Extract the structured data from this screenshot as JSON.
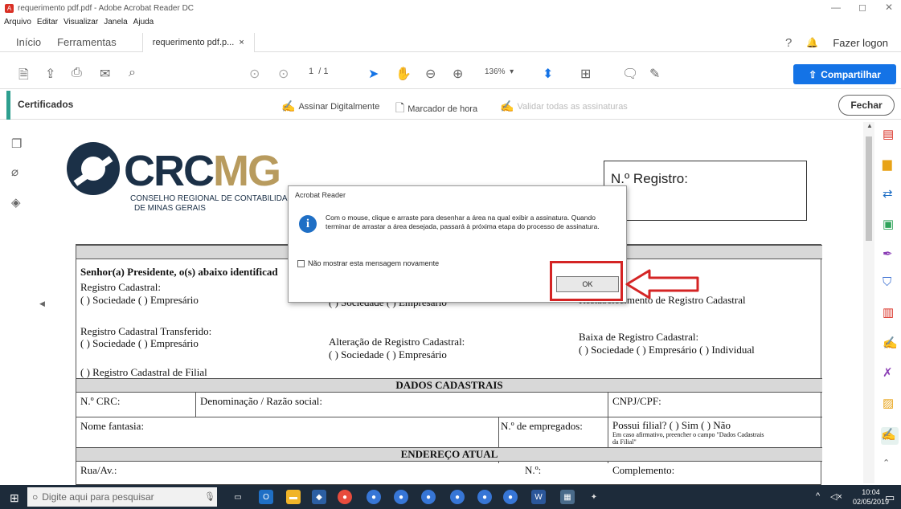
{
  "window": {
    "title": "requerimento pdf.pdf - Adobe Acrobat Reader DC",
    "minimize_icon": "minimize-icon",
    "maximize_icon": "maximize-icon",
    "close_icon": "close-icon"
  },
  "menubar": {
    "items": [
      "Arquivo",
      "Editar",
      "Visualizar",
      "Janela",
      "Ajuda"
    ]
  },
  "tabs": {
    "home": "Início",
    "tools": "Ferramentas",
    "document": "requerimento pdf.p...",
    "close_glyph": "×",
    "login": "Fazer logon"
  },
  "toolbar": {
    "page_current": "1",
    "page_total": "/ 1",
    "zoom": "136%",
    "share_label": "Compartilhar"
  },
  "certificates": {
    "label": "Certificados",
    "sign": "Assinar Digitalmente",
    "timestamp": "Marcador de hora",
    "validate": "Validar todas as assinaturas",
    "close": "Fechar"
  },
  "document": {
    "logo_crc": "CRC",
    "logo_mg": "MG",
    "logo_sub1": "CONSELHO REGIONAL DE CONTABILIDADE",
    "logo_sub2": "DE MINAS GERAIS",
    "registro_label": "N.º Registro:",
    "senhor": "Senhor(a) Presidente, o(s) abaixo identificad",
    "reg_cadastral": "Registro Cadastral:",
    "opt_soc_emp": "( ) Sociedade  ( ) Empresário",
    "opt_soc_emp_partial": "( ) Sociedade  ( ) Empresário",
    "restab": "Restabelecimento de Registro Cadastral",
    "reg_transferido": "Registro Cadastral Transferido:",
    "opt_soc_emp2": "( ) Sociedade  ( ) Empresário",
    "alteracao": "Alteração de Registro Cadastral:",
    "opt_soc_emp3": "( ) Sociedade  ( ) Empresário",
    "baixa": "Baixa de Registro Cadastral:",
    "opt_baixa": "( ) Sociedade   ( ) Empresário   ( ) Individual",
    "filial": "( ) Registro Cadastral de Filial",
    "dados_cadastrais": "DADOS CADASTRAIS",
    "n_crc": "N.º CRC:",
    "denominacao": "Denominação / Razão social:",
    "cnpj": "CNPJ/CPF:",
    "nome_fantasia": "Nome fantasia:",
    "n_empregados": "N.º de empregados:",
    "possui_filial": "Possui filial?     (    ) Sim       (    ) Não",
    "caso_afirmativo": "Em caso afirmativo, preencher o campo \"Dados Cadastrais",
    "da_filial": "da Filial\"",
    "endereco_atual": "ENDEREÇO ATUAL",
    "rua": "Rua/Av.:",
    "numero": "N.º:",
    "complemento": "Complemento:"
  },
  "dialog": {
    "title": "Acrobat Reader",
    "icon": "info-icon",
    "message": "Com o mouse, clique e arraste para desenhar a área na qual exibir a assinatura. Quando terminar de arrastar a área desejada, passará à próxima etapa do processo de assinatura.",
    "checkbox_label": "Não mostrar esta mensagem novamente",
    "ok": "OK"
  },
  "taskbar": {
    "search_placeholder": "Digite aqui para pesquisar",
    "time": "10:04",
    "date": "02/05/2019"
  },
  "colors": {
    "accent_blue": "#1473e6",
    "highlight_red": "#d42424",
    "cert_accent": "#2d9f8f"
  }
}
